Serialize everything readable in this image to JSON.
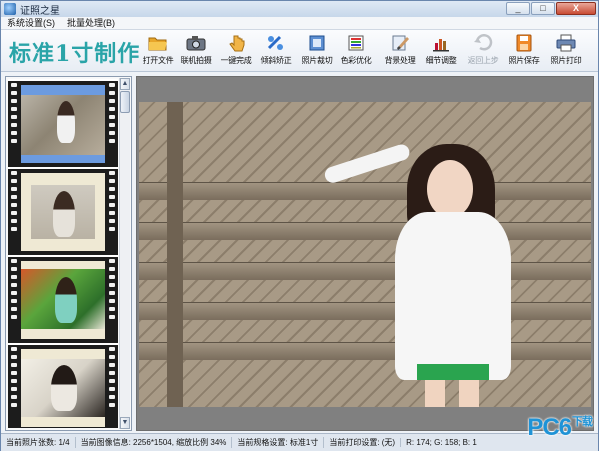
{
  "window": {
    "title": "证照之星",
    "minimize": "_",
    "maximize": "□",
    "close": "X"
  },
  "menu": [
    "系统设置(S)",
    "批量处理(B)"
  ],
  "brand": "标准1寸制作",
  "toolbar": {
    "open_file": "打开文件",
    "camera_capture": "联机拍摄",
    "one_click": "一键完成",
    "tilt_correct": "倾斜矫正",
    "photo_crop": "照片裁切",
    "color_optimize": "色彩优化",
    "background": "背景处理",
    "detail_adjust": "细节调整",
    "undo": "返回上步",
    "save_photo": "照片保存",
    "print_photo": "照片打印"
  },
  "scroll": {
    "up": "▲",
    "down": "▼"
  },
  "status": {
    "photo_count": "当前照片张数: 1/4",
    "image_info": "当前图像信息: 2256*1504, 缩放比例 34%",
    "spec": "当前规格设置: 标准1寸",
    "print_setting": "当前打印设置: (无)",
    "color_readout": "R: 174; G: 158; B: 1"
  },
  "watermark": {
    "main": "PC6",
    "sub": "下载"
  },
  "colors": {
    "brand": "#2aa4a8",
    "selection": "#6c9be0",
    "watermark": "#1f93d6"
  },
  "icons": [
    "open-folder-icon",
    "camera-icon",
    "one-click-hand-icon",
    "tilt-correct-icon",
    "crop-icon",
    "color-bars-icon",
    "background-brush-icon",
    "detail-chart-icon",
    "undo-arrow-icon",
    "save-disk-icon",
    "printer-icon"
  ]
}
